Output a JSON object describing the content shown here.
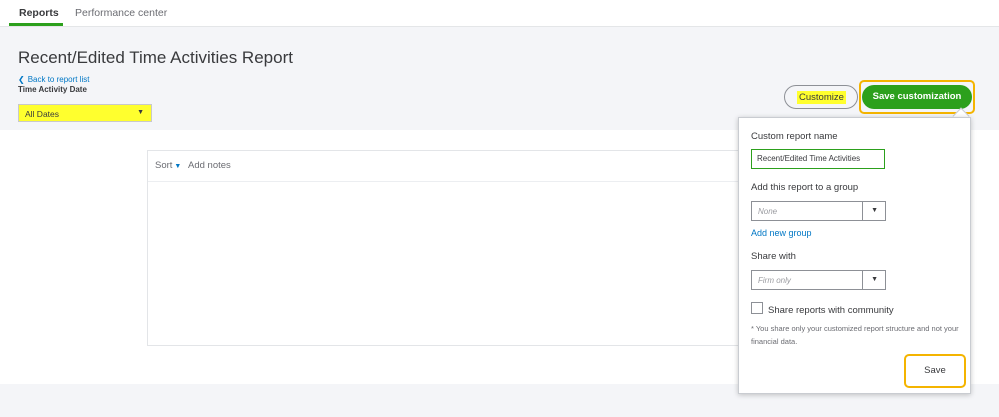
{
  "tabs": [
    {
      "label": "Reports",
      "active": true
    },
    {
      "label": "Performance center",
      "active": false
    }
  ],
  "header": {
    "title": "Recent/Edited Time Activities Report",
    "back_link": "Back to report list",
    "date_label": "Time Activity Date",
    "date_value": "All Dates"
  },
  "actions": {
    "customize": "Customize",
    "save_customization": "Save customization"
  },
  "report": {
    "sort_label": "Sort",
    "add_notes": "Add notes"
  },
  "customize_panel": {
    "name_label": "Custom report name",
    "name_value": "Recent/Edited Time Activities",
    "group_label": "Add this report to a group",
    "group_value": "None",
    "add_group_link": "Add new group",
    "share_label": "Share with",
    "share_value": "Firm only",
    "community_label": "Share reports with community",
    "community_checked": false,
    "community_note": "* You share only your customized report structure and not your financial data.",
    "save_label": "Save"
  },
  "colors": {
    "accent_green": "#2ca01c",
    "highlight_yellow": "#ffff2e",
    "outline_orange": "#f4b400",
    "link_blue": "#0077c5"
  }
}
